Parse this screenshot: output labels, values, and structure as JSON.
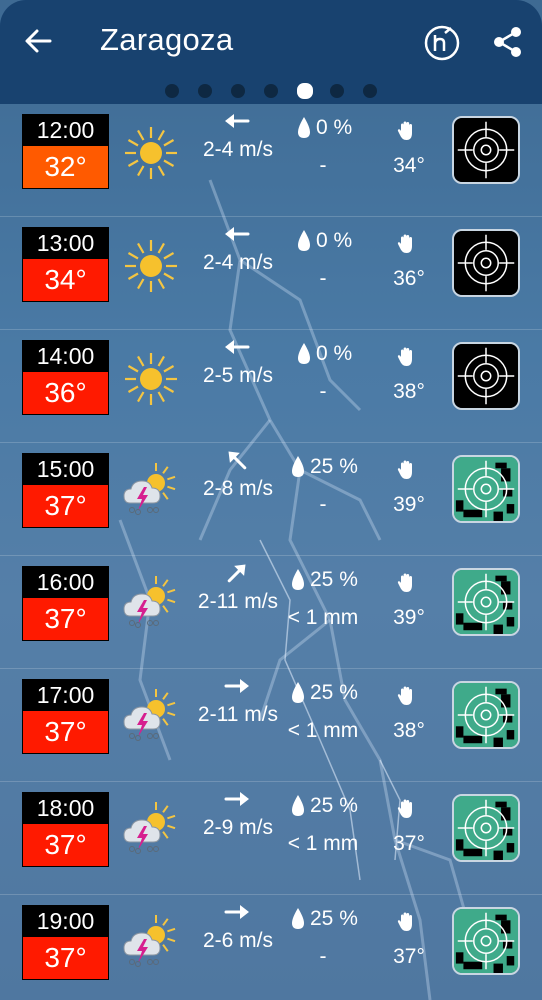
{
  "header": {
    "city": "Zaragoza",
    "back_icon": "arrow-left-icon",
    "history_icon": "history-h-icon",
    "share_icon": "share-icon"
  },
  "pager": {
    "count": 7,
    "active_index": 4
  },
  "colors": {
    "header_bg": "#18426f",
    "temp_orange": "#ff5a00",
    "temp_red": "#ff1a00",
    "radar_green": "#3faa8a",
    "radar_black": "#000000"
  },
  "rows": [
    {
      "time": "12:00",
      "temp": "32°",
      "temp_color": "#ff5a00",
      "icon": "sun-icon",
      "wind_arrow": "arrow-left",
      "wind": "2-4 m/s",
      "precip_prob": "0 %",
      "precip_amount": "-",
      "feels_like": "34°",
      "radar": "black"
    },
    {
      "time": "13:00",
      "temp": "34°",
      "temp_color": "#ff1a00",
      "icon": "sun-icon",
      "wind_arrow": "arrow-left",
      "wind": "2-4 m/s",
      "precip_prob": "0 %",
      "precip_amount": "-",
      "feels_like": "36°",
      "radar": "black"
    },
    {
      "time": "14:00",
      "temp": "36°",
      "temp_color": "#ff1a00",
      "icon": "sun-icon",
      "wind_arrow": "arrow-left",
      "wind": "2-5 m/s",
      "precip_prob": "0 %",
      "precip_amount": "-",
      "feels_like": "38°",
      "radar": "black"
    },
    {
      "time": "15:00",
      "temp": "37°",
      "temp_color": "#ff1a00",
      "icon": "thunder-cloud-sun-icon",
      "wind_arrow": "arrow-up-left",
      "wind": "2-8 m/s",
      "precip_prob": "25 %",
      "precip_amount": "-",
      "feels_like": "39°",
      "radar": "green"
    },
    {
      "time": "16:00",
      "temp": "37°",
      "temp_color": "#ff1a00",
      "icon": "thunder-cloud-sun-icon",
      "wind_arrow": "arrow-up-right",
      "wind": "2-11 m/s",
      "precip_prob": "25 %",
      "precip_amount": "< 1 mm",
      "feels_like": "39°",
      "radar": "green"
    },
    {
      "time": "17:00",
      "temp": "37°",
      "temp_color": "#ff1a00",
      "icon": "thunder-cloud-sun-icon",
      "wind_arrow": "arrow-right",
      "wind": "2-11 m/s",
      "precip_prob": "25 %",
      "precip_amount": "< 1 mm",
      "feels_like": "38°",
      "radar": "green"
    },
    {
      "time": "18:00",
      "temp": "37°",
      "temp_color": "#ff1a00",
      "icon": "thunder-cloud-sun-icon",
      "wind_arrow": "arrow-right",
      "wind": "2-9 m/s",
      "precip_prob": "25 %",
      "precip_amount": "< 1 mm",
      "feels_like": "37°",
      "radar": "green"
    },
    {
      "time": "19:00",
      "temp": "37°",
      "temp_color": "#ff1a00",
      "icon": "thunder-cloud-sun-icon",
      "wind_arrow": "arrow-right",
      "wind": "2-6 m/s",
      "precip_prob": "25 %",
      "precip_amount": "-",
      "feels_like": "37°",
      "radar": "green"
    }
  ]
}
